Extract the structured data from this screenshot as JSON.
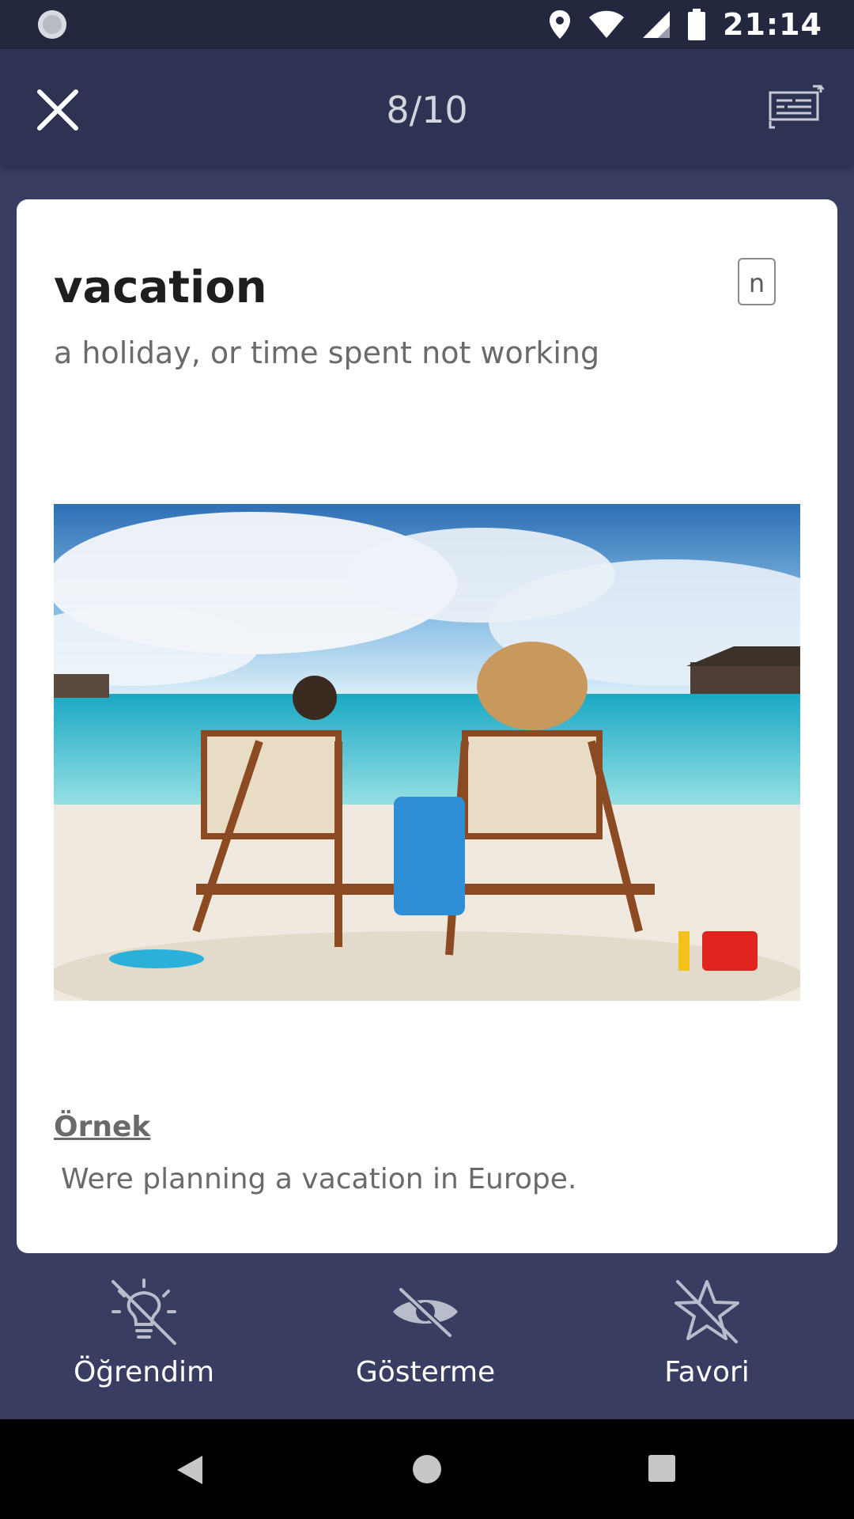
{
  "status_bar": {
    "time": "21:14"
  },
  "app_bar": {
    "progress": "8/10"
  },
  "card": {
    "word": "vacation",
    "part_of_speech": "n",
    "definition": "a holiday, or time spent not working",
    "example_label": "Örnek",
    "example_text": "Were planning a vacation in Europe."
  },
  "actions": {
    "learned": "Öğrendim",
    "hide": "Gösterme",
    "favorite": "Favori"
  }
}
